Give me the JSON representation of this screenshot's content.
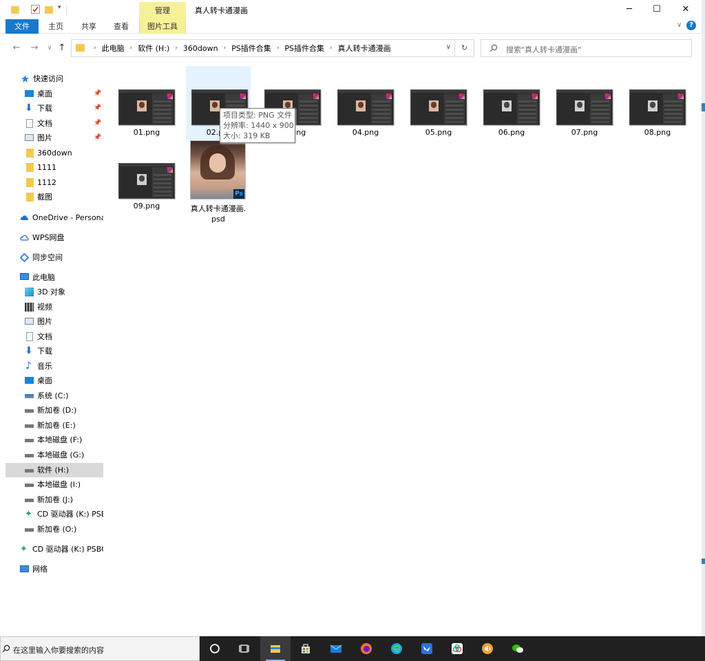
{
  "window": {
    "title": "真人转卡通漫画",
    "manage_tab": "管理",
    "controls": {
      "minimize": "─",
      "maximize": "☐",
      "close": "✕"
    }
  },
  "ribbon": {
    "tabs": [
      {
        "label": "文件",
        "active": true
      },
      {
        "label": "主页"
      },
      {
        "label": "共享"
      },
      {
        "label": "查看"
      },
      {
        "label": "图片工具"
      }
    ]
  },
  "address": {
    "crumbs": [
      "此电脑",
      "软件 (H:)",
      "360down",
      "PS插件合集",
      "PS插件合集",
      "真人转卡通漫画"
    ]
  },
  "search": {
    "placeholder": "搜索\"真人转卡通漫画\""
  },
  "nav": {
    "quick_access": "快速访问",
    "pinned": [
      "桌面",
      "下载",
      "文档",
      "图片"
    ],
    "folders": [
      "360down",
      "1111",
      "1112",
      "截图"
    ],
    "onedrive": "OneDrive - Persona",
    "wps": "WPS网盘",
    "sync": "同步空间",
    "this_pc": "此电脑",
    "pc_items": [
      "3D 对象",
      "视频",
      "图片",
      "文档",
      "下载",
      "音乐",
      "桌面"
    ],
    "drives": [
      "系统 (C:)",
      "新加卷 (D:)",
      "新加卷 (E:)",
      "本地磁盘 (F:)",
      "本地磁盘 (G:)",
      "软件 (H:)",
      "本地磁盘 (I:)",
      "新加卷 (J:)",
      "CD 驱动器 (K:) PSE",
      "新加卷 (O:)"
    ],
    "cd_drive": "CD 驱动器 (K:) PSBC",
    "network": "网络"
  },
  "files": [
    {
      "name": "01.png",
      "style": "color"
    },
    {
      "name": "02.png",
      "style": "color",
      "selected": true
    },
    {
      "name": "03.png",
      "style": "color"
    },
    {
      "name": "04.png",
      "style": "color"
    },
    {
      "name": "05.png",
      "style": "color"
    },
    {
      "name": "06.png",
      "style": "bw"
    },
    {
      "name": "07.png",
      "style": "bw"
    },
    {
      "name": "08.png",
      "style": "bw"
    },
    {
      "name": "09.png",
      "style": "bw"
    }
  ],
  "psd_file": {
    "name_line1": "真人转卡通漫画.",
    "name_line2": "psd",
    "badge": "Ps"
  },
  "tooltip": {
    "type": "项目类型: PNG 文件",
    "resolution": "分辨率: 1440 x 900",
    "size": "大小: 319 KB"
  },
  "taskbar": {
    "search_text": "在这里输入你要搜索的内容",
    "apps": [
      "cortana",
      "task-view",
      "file-explorer",
      "store",
      "mail",
      "firefox",
      "edge",
      "feishu",
      "baidu-netdisk",
      "audio-app",
      "wechat"
    ]
  },
  "colors": {
    "accent": "#1979ca",
    "manage_tab": "#f6f098",
    "folder": "#f4c94e",
    "selection": "#e5f3ff"
  }
}
